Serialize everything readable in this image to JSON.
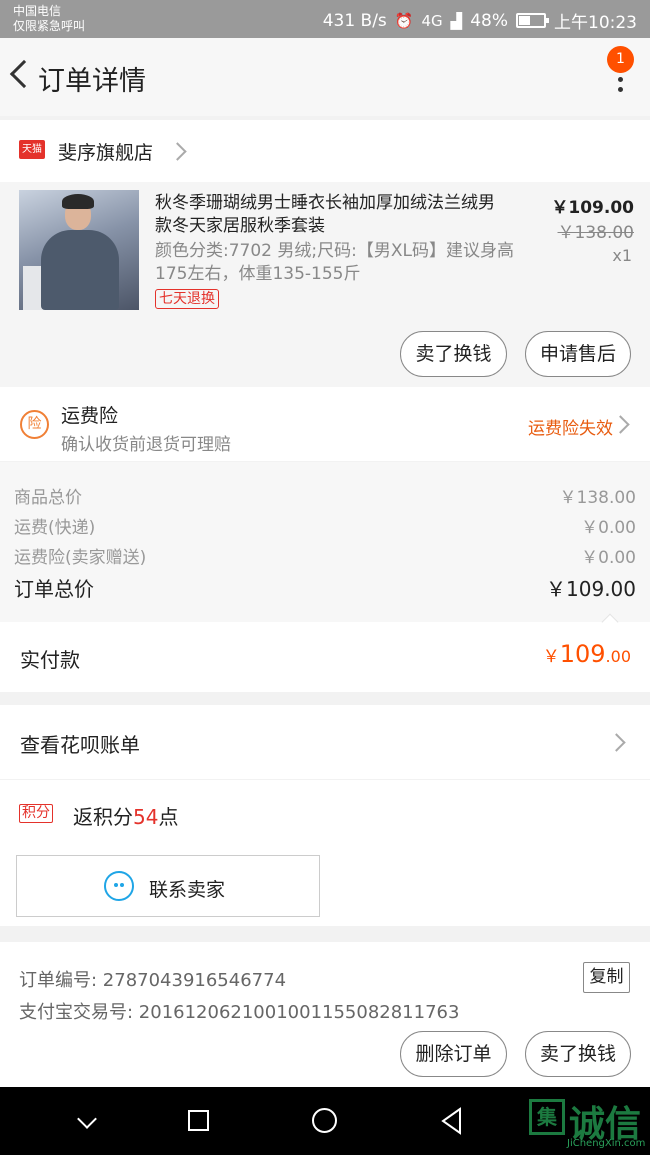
{
  "status_bar": {
    "carrier_line1": "中国电信",
    "carrier_line2": "仅限紧急呼叫",
    "net_speed": "431 B/s",
    "signal": "4G",
    "battery": "48%",
    "time": "上午10:23"
  },
  "header": {
    "title": "订单详情",
    "notification_count": "1"
  },
  "shop": {
    "badge": "天猫",
    "name": "斐序旗舰店"
  },
  "item": {
    "title": "秋冬季珊瑚绒男士睡衣长袖加厚加绒法兰绒男款冬天家居服秋季套装",
    "sku": "颜色分类:7702 男绒;尺码:【男XL码】建议身高175左右，体重135-155斤",
    "tag": "七天退换",
    "price": "￥109.00",
    "original_price": "￥138.00",
    "quantity": "x1",
    "buttons": [
      "卖了换钱",
      "申请售后"
    ]
  },
  "insurance": {
    "icon_text": "险",
    "title": "运费险",
    "subtitle": "确认收货前退货可理赔",
    "status": "运费险失效"
  },
  "summary": {
    "rows": [
      {
        "label": "商品总价",
        "value": "￥138.00"
      },
      {
        "label": "运费(快递)",
        "value": "￥0.00"
      },
      {
        "label": "运费险(卖家赠送)",
        "value": "￥0.00"
      }
    ],
    "total_label": "订单总价",
    "total_value": "￥109.00"
  },
  "payment": {
    "label": "实付款",
    "symbol": "￥",
    "integer": "109",
    "decimal": ".00"
  },
  "huabei": {
    "label": "查看花呗账单"
  },
  "points": {
    "tag": "积分",
    "prefix": "返积分",
    "count": "54",
    "suffix": "点"
  },
  "contact": {
    "label": "联系卖家"
  },
  "order_info": {
    "order_no": "订单编号: 2787043916546774",
    "alipay_no": "支付宝交易号: 2016120621001001155082811763",
    "copy_label": "复制"
  },
  "footer_actions": {
    "delete_label": "删除订单",
    "resell_label": "卖了换钱"
  },
  "watermark": {
    "box_char": "集",
    "cn": "诚信",
    "en": "JiChengXin.com"
  },
  "colors": {
    "accent": "#ff5000",
    "tmall_red": "#e4322b",
    "insurance_orange": "#e85c10",
    "wangwang_blue": "#1fa5e6"
  }
}
